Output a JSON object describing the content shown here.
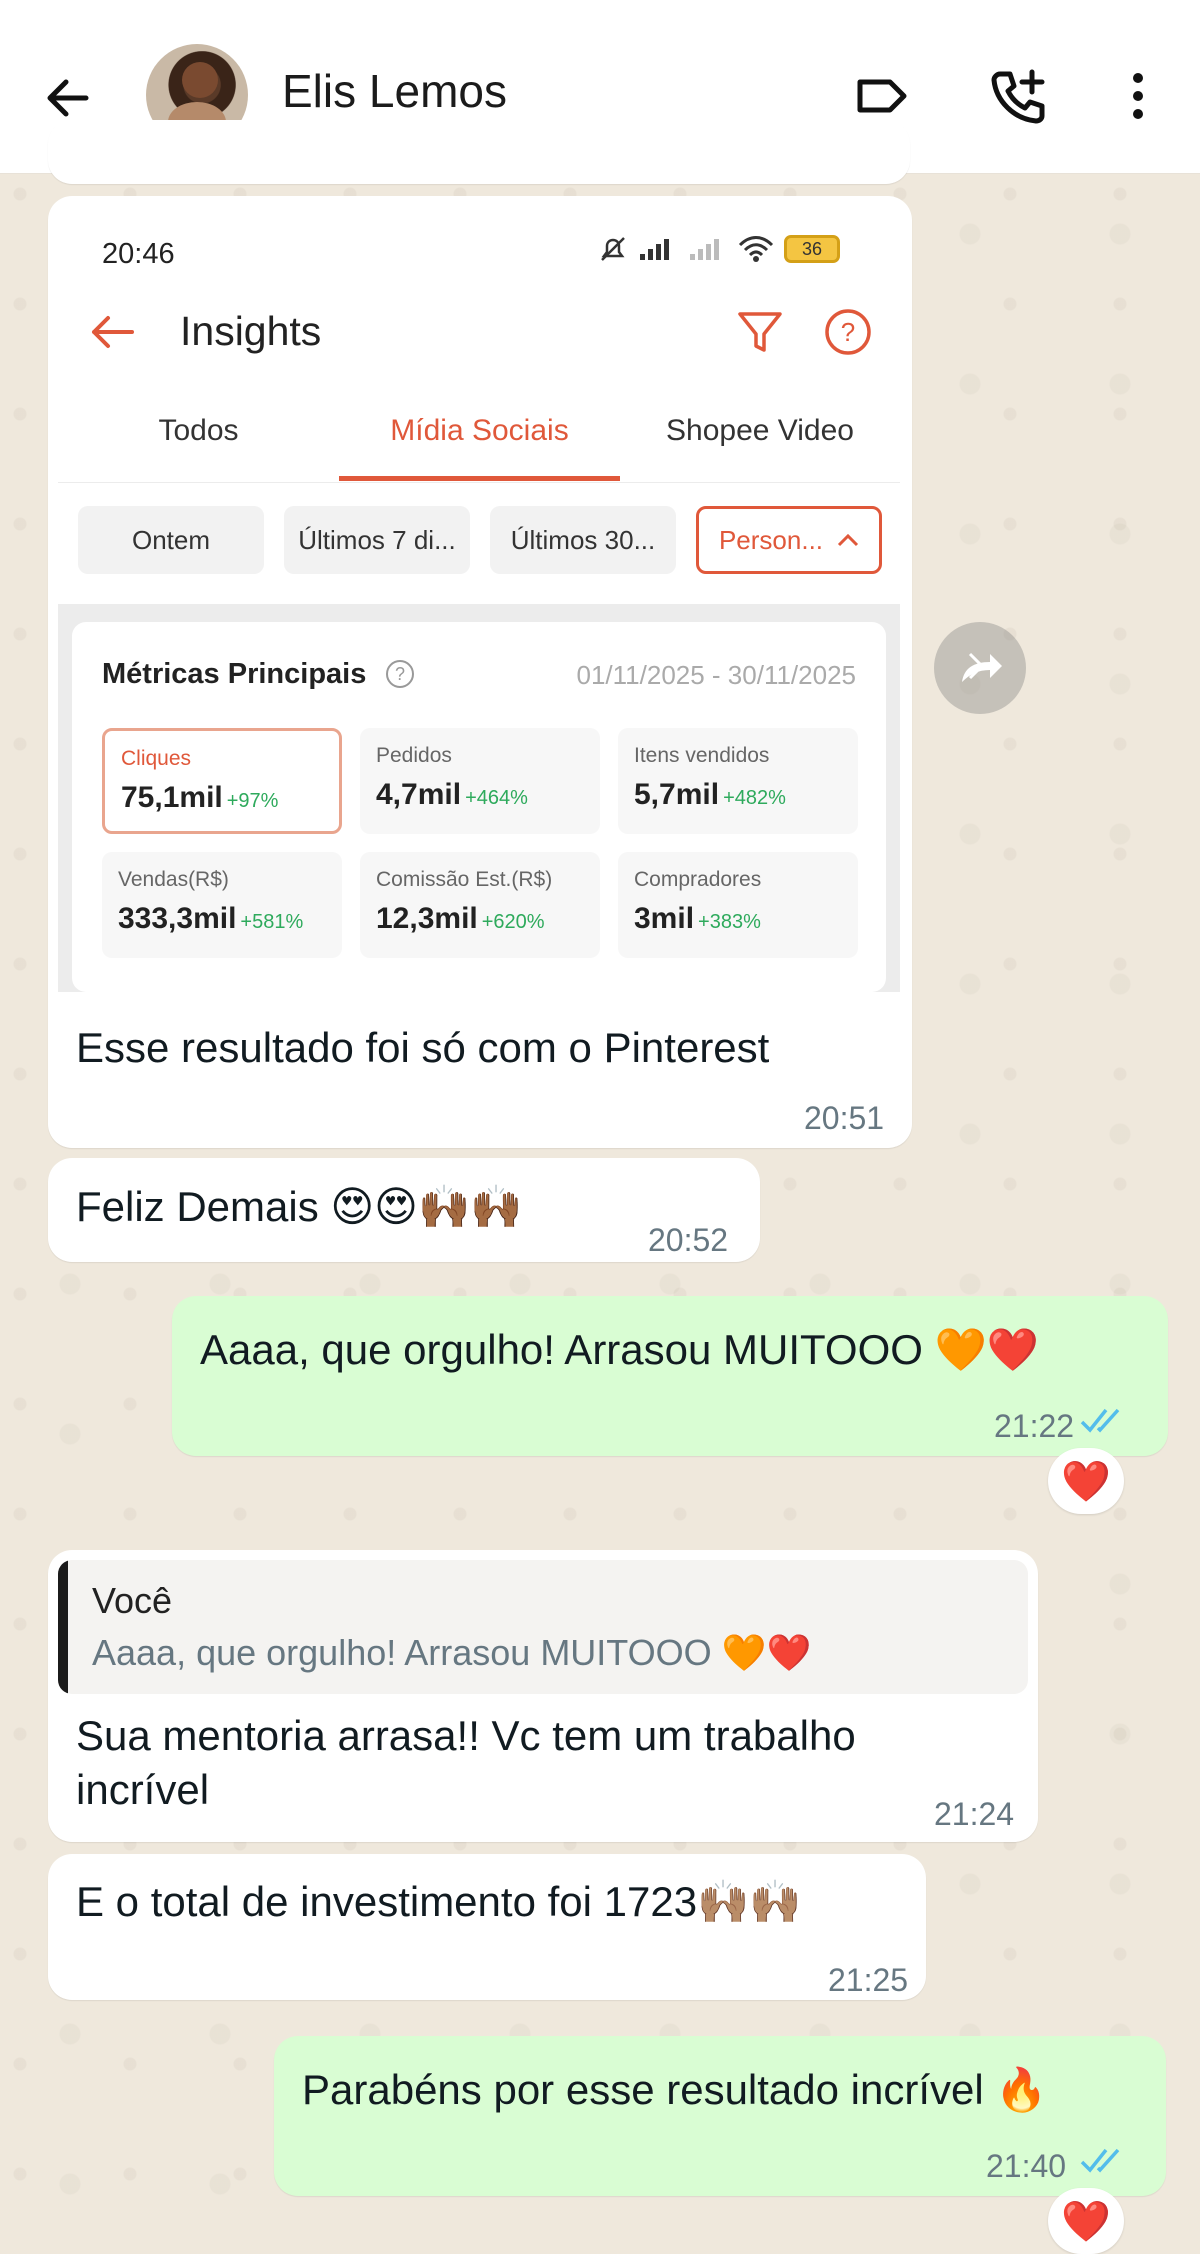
{
  "header": {
    "contact_name": "Elis Lemos"
  },
  "screenshot": {
    "status_time": "20:46",
    "battery": "36",
    "title": "Insights",
    "tabs": [
      "Todos",
      "Mídia Sociais",
      "Shopee Video"
    ],
    "active_tab": "Mídia Sociais",
    "chips": [
      "Ontem",
      "Últimos 7 di...",
      "Últimos 30...",
      "Person..."
    ],
    "metrics_title": "Métricas Principais",
    "date_range": "01/11/2025 - 30/11/2025",
    "metrics": [
      {
        "label": "Cliques",
        "value": "75,1mil",
        "delta": "+97%"
      },
      {
        "label": "Pedidos",
        "value": "4,7mil",
        "delta": "+464%"
      },
      {
        "label": "Itens vendidos",
        "value": "5,7mil",
        "delta": "+482%"
      },
      {
        "label": "Vendas(R$)",
        "value": "333,3mil",
        "delta": "+581%"
      },
      {
        "label": "Comissão Est.(R$)",
        "value": "12,3mil",
        "delta": "+620%"
      },
      {
        "label": "Compradores",
        "value": "3mil",
        "delta": "+383%"
      }
    ]
  },
  "messages": [
    {
      "direction": "in",
      "text": "Esse resultado foi só com o Pinterest",
      "time": "20:51"
    },
    {
      "direction": "in",
      "text": "Feliz Demais 😍😍🙌🏾🙌🏾",
      "time": "20:52"
    },
    {
      "direction": "out",
      "text": "Aaaa, que orgulho! Arrasou MUITOOO 🧡❤️",
      "time": "21:22",
      "reaction": "❤️"
    },
    {
      "direction": "in",
      "quote_author": "Você",
      "quote_text": "Aaaa, que orgulho! Arrasou MUITOOO 🧡❤️",
      "text_line1": "Sua mentoria arrasa!! Vc tem um trabalho",
      "text_line2": "incrível",
      "time": "21:24"
    },
    {
      "direction": "in",
      "text": "E o total de investimento foi 1723🙌🏽🙌🏽",
      "time": "21:25"
    },
    {
      "direction": "out",
      "text": "Parabéns por esse resultado incrível 🔥",
      "time": "21:40",
      "reaction": "❤️"
    }
  ],
  "colors": {
    "accent": "#e0583a",
    "outgoing_bubble": "#d9fdd3",
    "read_ticks": "#53bdeb",
    "delta_green": "#2eaa5c"
  }
}
